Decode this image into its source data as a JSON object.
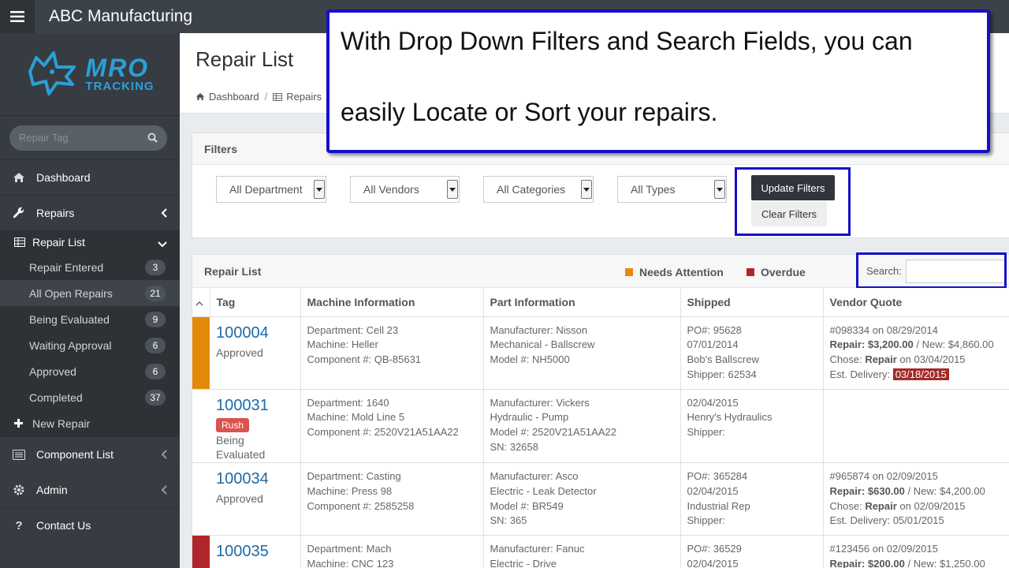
{
  "app": {
    "title": "ABC Manufacturing"
  },
  "logo": {
    "line1": "MRO",
    "line2": "TRACKING"
  },
  "sidebar": {
    "search_placeholder": "Repair Tag",
    "nav": {
      "dashboard": "Dashboard",
      "repairs": "Repairs",
      "repair_list": "Repair List",
      "new_repair": "New Repair",
      "component_list": "Component List",
      "admin": "Admin",
      "contact_us": "Contact Us"
    },
    "sub_items": [
      {
        "label": "Repair Entered",
        "count": "3"
      },
      {
        "label": "All Open Repairs",
        "count": "21"
      },
      {
        "label": "Being Evaluated",
        "count": "9"
      },
      {
        "label": "Waiting Approval",
        "count": "6"
      },
      {
        "label": "Approved",
        "count": "6"
      },
      {
        "label": "Completed",
        "count": "37"
      }
    ]
  },
  "header": {
    "title": "Repair List",
    "breadcrumb": [
      "Dashboard",
      "Repairs"
    ]
  },
  "filters": {
    "title": "Filters",
    "selects": [
      "All Department",
      "All Vendors",
      "All Categories",
      "All Types"
    ],
    "update": "Update Filters",
    "clear": "Clear Filters"
  },
  "list": {
    "title": "Repair List",
    "legend": [
      {
        "label": "Needs Attention",
        "color": "#e5890a"
      },
      {
        "label": "Overdue",
        "color": "#b0262b"
      }
    ],
    "search_label": "Search:",
    "columns": [
      "Tag",
      "Machine Information",
      "Part Information",
      "Shipped",
      "Vendor Quote"
    ],
    "rows": [
      {
        "mark": "#e5890a",
        "tag": "100004",
        "rush": "",
        "status": "Approved",
        "machine": [
          "Department: Cell 23",
          "Machine: Heller",
          "Component #: QB-85631"
        ],
        "part": [
          "Manufacturer: Nisson",
          "Mechanical - Ballscrew",
          "Model #: NH5000"
        ],
        "shipped": [
          "PO#: 95628",
          "07/01/2014",
          "Bob's Ballscrew",
          "Shipper: 62534"
        ],
        "quote": {
          "line1": "#098334 on 08/29/2014",
          "repair_label": "Repair: $3,200.00",
          "new_text": " / New: $4,860.00",
          "chose_pre": "Chose: ",
          "chose_bold": "Repair",
          "chose_post": " on 03/04/2015",
          "delivery_pre": "Est. Delivery: ",
          "delivery_date": "03/18/2015",
          "overdue": true
        }
      },
      {
        "mark": "",
        "tag": "100031",
        "rush": "Rush",
        "status": "Being Evaluated",
        "machine": [
          "Department: 1640",
          "Machine: Mold Line 5",
          "Component #: 2520V21A51AA22"
        ],
        "part": [
          "Manufacturer: Vickers",
          "Hydraulic - Pump",
          "Model #: 2520V21A51AA22",
          "SN: 32658"
        ],
        "shipped": [
          "02/04/2015",
          "Henry's Hydraulics",
          "Shipper:"
        ],
        "quote": null
      },
      {
        "mark": "",
        "tag": "100034",
        "rush": "",
        "status": "Approved",
        "machine": [
          "Department: Casting",
          "Machine: Press 98",
          "Component #: 2585258"
        ],
        "part": [
          "Manufacturer: Asco",
          "Electric - Leak Detector",
          "Model #: BR549",
          "SN: 365"
        ],
        "shipped": [
          "PO#: 365284",
          "02/04/2015",
          "Industrial Rep",
          "Shipper:"
        ],
        "quote": {
          "line1": "#965874 on 02/09/2015",
          "repair_label": "Repair: $630.00",
          "new_text": " / New: $4,200.00",
          "chose_pre": "Chose: ",
          "chose_bold": "Repair",
          "chose_post": " on 02/09/2015",
          "delivery_pre": "Est. Delivery: ",
          "delivery_date": "05/01/2015",
          "overdue": false
        }
      },
      {
        "mark": "#b0262b",
        "tag": "100035",
        "rush": "",
        "status": "",
        "machine": [
          "Department: Mach",
          "Machine: CNC 123"
        ],
        "part": [
          "Manufacturer: Fanuc",
          "Electric - Drive"
        ],
        "shipped": [
          "PO#: 36529",
          "02/04/2015"
        ],
        "quote": {
          "line1": "#123456 on 02/09/2015",
          "repair_label": "Repair: $200.00",
          "new_text": " / New: $1,250.00",
          "chose_pre": "",
          "chose_bold": "",
          "chose_post": "",
          "delivery_pre": "",
          "delivery_date": "",
          "overdue": false
        }
      }
    ]
  },
  "callout": {
    "line1": "With Drop Down Filters and Search Fields, you can",
    "line2": "easily Locate or Sort your repairs."
  },
  "colors": {
    "accent": "#1410c8",
    "needs_attention": "#e5890a",
    "overdue": "#b0262b",
    "link": "#1e6aa6"
  }
}
